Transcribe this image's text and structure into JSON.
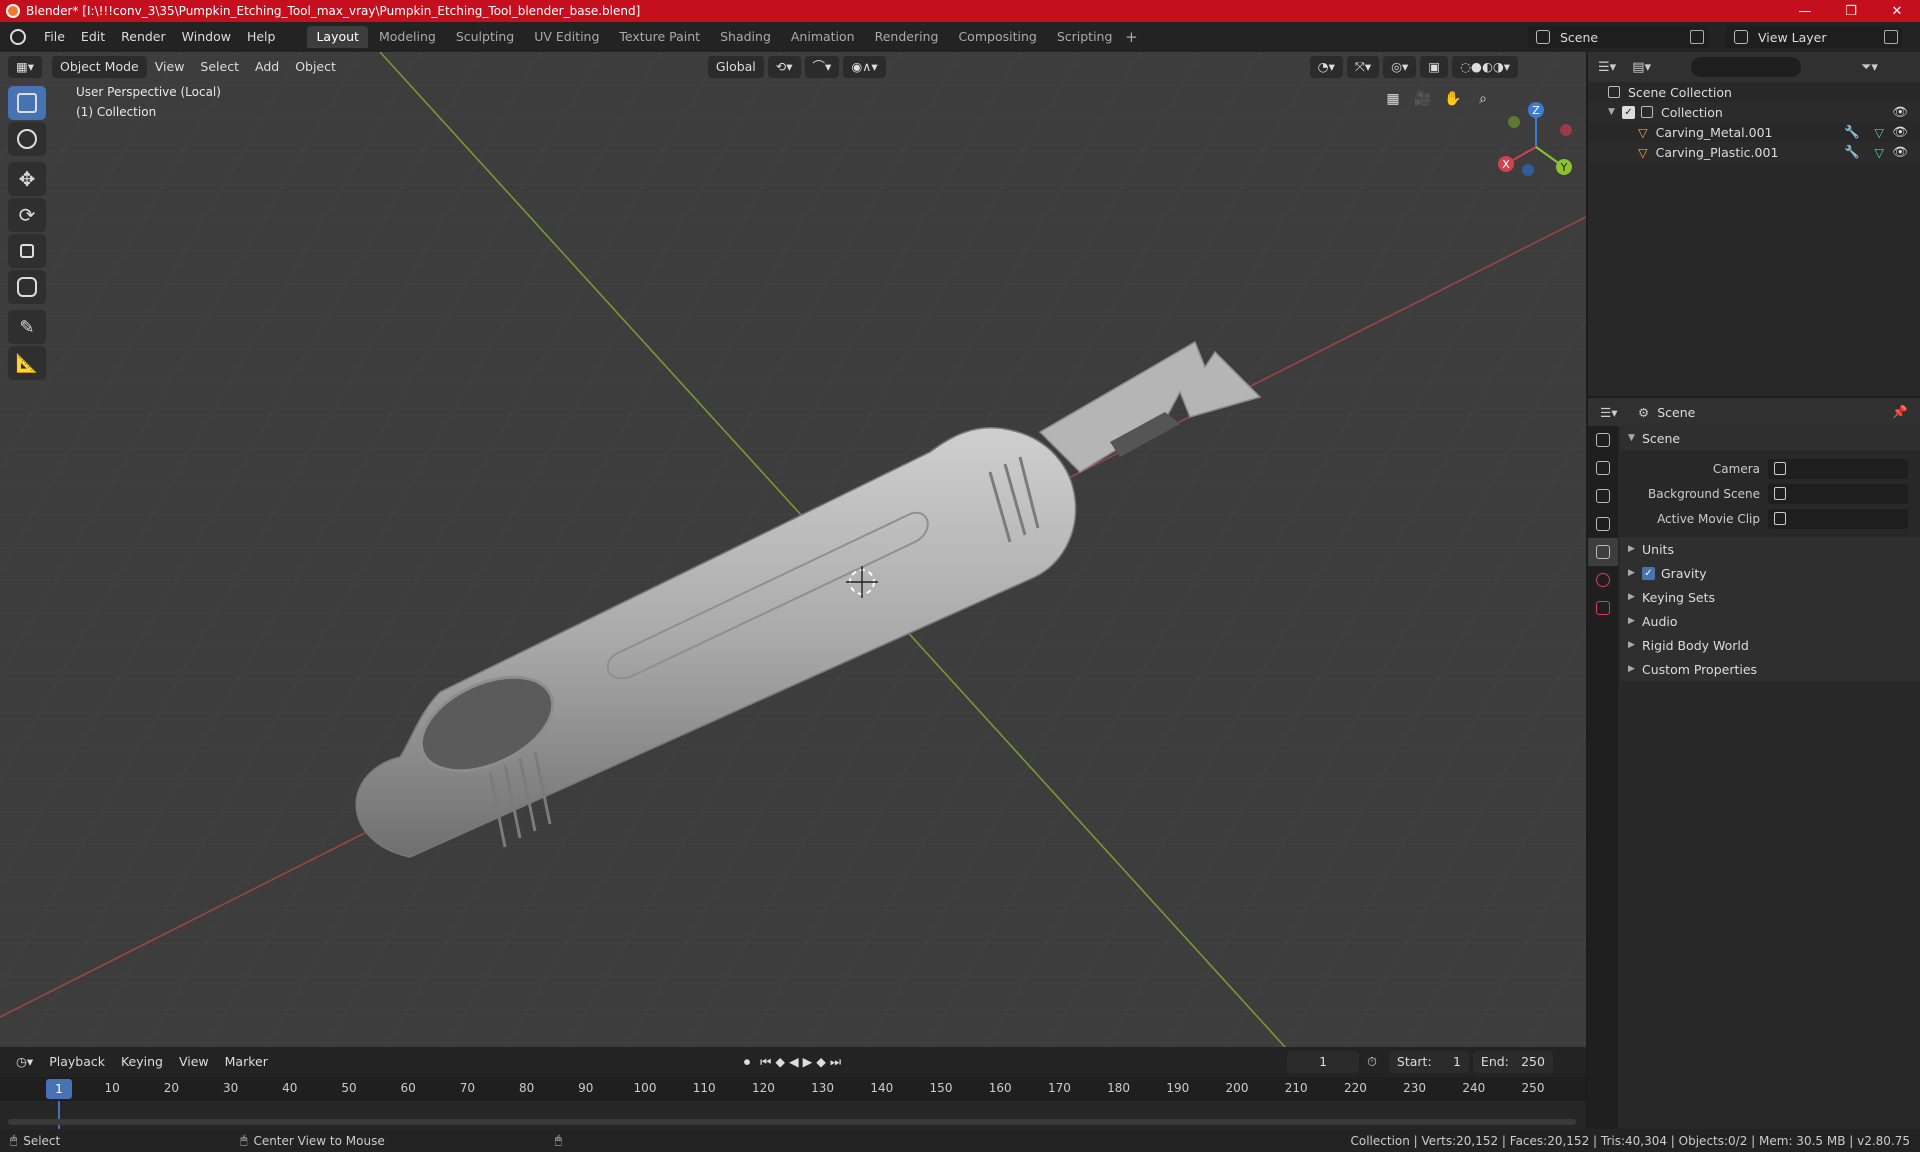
{
  "window": {
    "title": "Blender* [I:\\!!!conv_3\\35\\Pumpkin_Etching_Tool_max_vray\\Pumpkin_Etching_Tool_blender_base.blend]",
    "minimize": "—",
    "maximize": "❐",
    "close": "✕"
  },
  "menu": [
    "File",
    "Edit",
    "Render",
    "Window",
    "Help"
  ],
  "workspaces": [
    "Layout",
    "Modeling",
    "Sculpting",
    "UV Editing",
    "Texture Paint",
    "Shading",
    "Animation",
    "Rendering",
    "Compositing",
    "Scripting"
  ],
  "workspace_add": "+",
  "scene_selector": "Scene",
  "view_layer_selector": "View Layer",
  "viewport": {
    "mode": "Object Mode",
    "menus": [
      "View",
      "Select",
      "Add",
      "Object"
    ],
    "orientation": "Global",
    "overlay_line1": "User Perspective (Local)",
    "overlay_line2": "(1) Collection",
    "gizmo_x": "X",
    "gizmo_y": "Y",
    "gizmo_z": "Z"
  },
  "outliner": {
    "root": "Scene Collection",
    "collection": "Collection",
    "objects": [
      "Carving_Metal.001",
      "Carving_Plastic.001"
    ]
  },
  "properties": {
    "header": "Scene",
    "panel": "Scene",
    "fields": [
      {
        "label": "Camera"
      },
      {
        "label": "Background Scene"
      },
      {
        "label": "Active Movie Clip"
      }
    ],
    "subpanels": [
      "Units",
      "Gravity",
      "Keying Sets",
      "Audio",
      "Rigid Body World",
      "Custom Properties"
    ],
    "gravity_checked": true
  },
  "timeline": {
    "menus": [
      "Playback",
      "Keying",
      "View",
      "Marker"
    ],
    "current_frame": "1",
    "start_label": "Start:",
    "start": "1",
    "end_label": "End:",
    "end": "250",
    "ticks": [
      "10",
      "20",
      "30",
      "40",
      "50",
      "60",
      "70",
      "80",
      "90",
      "100",
      "110",
      "120",
      "130",
      "140",
      "150",
      "160",
      "170",
      "180",
      "190",
      "200",
      "210",
      "220",
      "230",
      "240",
      "250"
    ]
  },
  "status": {
    "select": "Select",
    "center": "Center View to Mouse",
    "stats": "Collection | Verts:20,152 | Faces:20,152 | Tris:40,304 | Objects:0/2 | Mem: 30.5 MB | v2.80.75"
  },
  "colors": {
    "accent": "#4772b3",
    "title_bar": "#c50f1f",
    "axis_x": "#b34a4a",
    "axis_y": "#8aa33b"
  }
}
